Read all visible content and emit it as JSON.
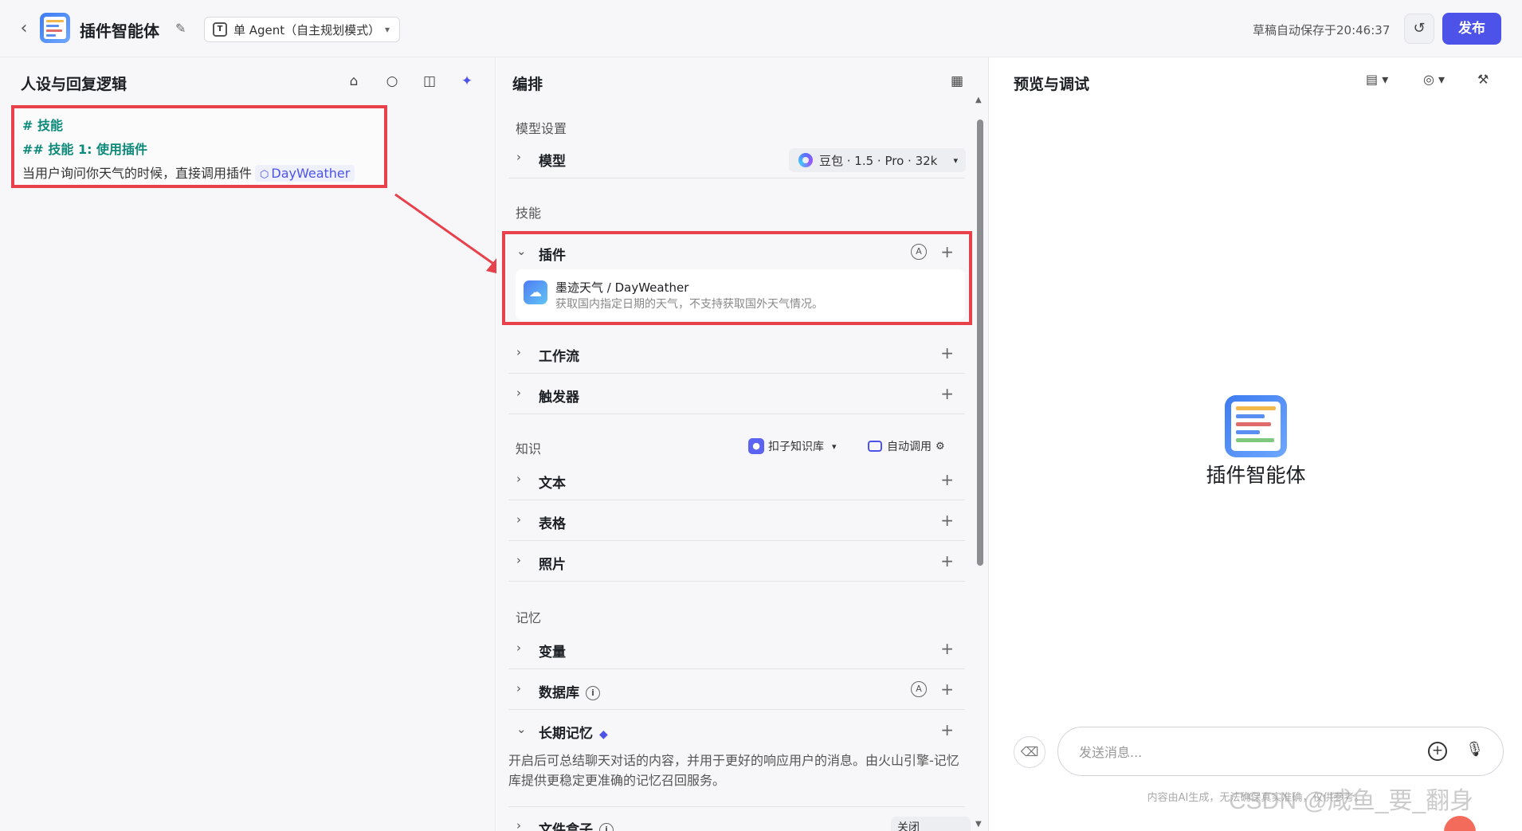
{
  "header": {
    "back_icon": "chevron-left-icon",
    "app_title": "插件智能体",
    "mode_label": "单 Agent（自主规划模式）",
    "autosave_text": "草稿自动保存于20:46:37",
    "publish_label": "发布"
  },
  "left_panel": {
    "title": "人设与回复逻辑",
    "prompt_lines": [
      "# 技能",
      "## 技能 1: 使用插件",
      "当用户询问你天气的时候，直接调用插件"
    ],
    "plugin_ref": "DayWeather"
  },
  "mid_panel": {
    "title": "编排",
    "model_section": "模型设置",
    "model_label": "模型",
    "model_value": "豆包 · 1.5 · Pro · 32k",
    "skills_section": "技能",
    "plugin_row": "插件",
    "plugin_name": "墨迹天气 / DayWeather",
    "plugin_desc": "获取国内指定日期的天气，不支持获取国外天气情况。",
    "workflow_row": "工作流",
    "trigger_row": "触发器",
    "knowledge_section": "知识",
    "kb_source": "扣子知识库",
    "kb_auto": "自动调用",
    "text_row": "文本",
    "table_row": "表格",
    "photo_row": "照片",
    "memory_section": "记忆",
    "variable_row": "变量",
    "database_row": "数据库",
    "longterm_row": "长期记忆",
    "longterm_desc": "开启后可总结聊天对话的内容，并用于更好的响应用户的消息。由火山引擎-记忆库提供更稳定更准确的记忆召回服务。",
    "filebox_row": "文件盒子",
    "filebox_value": "关闭"
  },
  "right_panel": {
    "title": "预览与调试",
    "bot_name": "插件智能体",
    "input_placeholder": "发送消息...",
    "disclaimer": "内容由AI生成，无法确保真实准确，仅供参考。",
    "watermark": "CSDN @咸鱼_要_翻身"
  },
  "colors": {
    "accent": "#4d53e8",
    "highlight_box": "#e8414c",
    "heading_teal": "#0d8a7a"
  }
}
